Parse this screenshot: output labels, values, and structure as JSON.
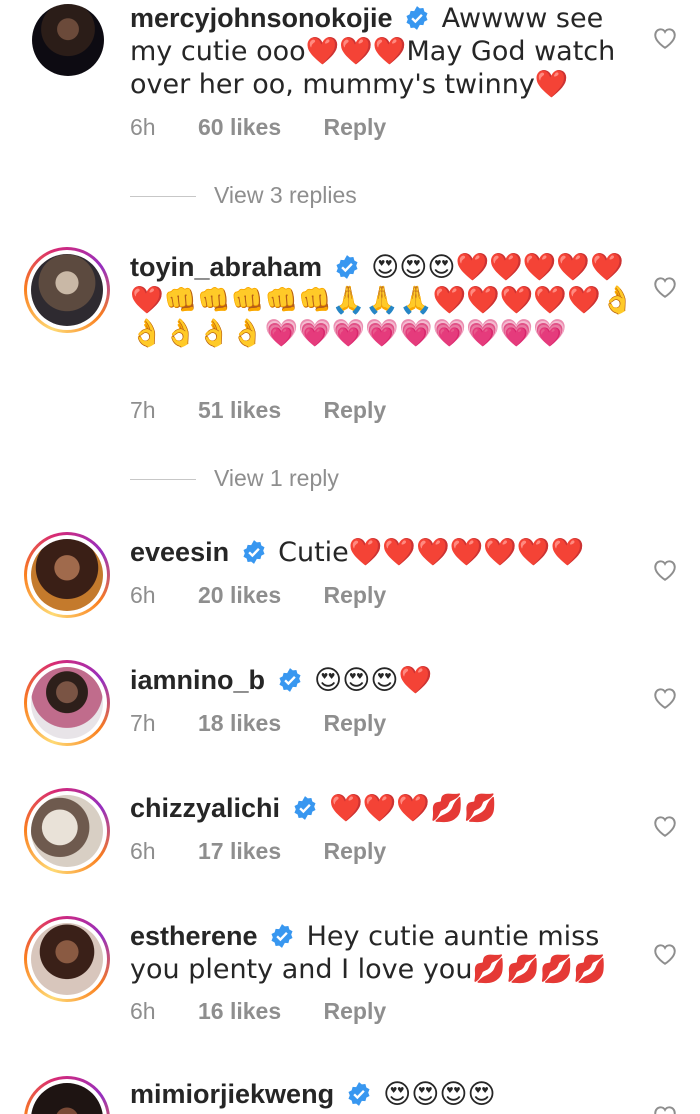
{
  "comments": [
    {
      "username": "mercyjohnsonokojie",
      "text": "Awwww see my cutie ooo❤️❤️❤️May God watch over her oo, mummy's twinny❤️",
      "time": "6h",
      "likes": "60 likes",
      "reply": "Reply",
      "view_replies": "View 3 replies"
    },
    {
      "username": "toyin_abraham",
      "text": "😍😍😍❤️❤️❤️❤️❤️❤️👊👊👊👊👊🙏🙏🙏❤️❤️❤️❤️❤️👌👌👌👌👌💗💗💗💗💗💗💗💗💗",
      "time": "7h",
      "likes": "51 likes",
      "reply": "Reply",
      "view_replies": "View 1 reply"
    },
    {
      "username": "eveesin",
      "text": "Cutie❤️❤️❤️❤️❤️❤️❤️",
      "time": "6h",
      "likes": "20 likes",
      "reply": "Reply"
    },
    {
      "username": "iamnino_b",
      "text": "😍😍😍❤️",
      "time": "7h",
      "likes": "18 likes",
      "reply": "Reply"
    },
    {
      "username": "chizzyalichi",
      "text": "❤️❤️❤️💋💋",
      "time": "6h",
      "likes": "17 likes",
      "reply": "Reply"
    },
    {
      "username": "estherene",
      "text": "Hey cutie auntie miss you plenty and I love you💋💋💋💋",
      "time": "6h",
      "likes": "16 likes",
      "reply": "Reply"
    },
    {
      "username": "mimiorjiekweng",
      "text": "😍😍😍😍"
    }
  ],
  "colors": {
    "verified": "#3897f0",
    "muted": "#8e8e8e",
    "heart": "#ed1c24"
  },
  "icons": {
    "verified": "verified-badge-icon",
    "like": "heart-outline-icon"
  }
}
